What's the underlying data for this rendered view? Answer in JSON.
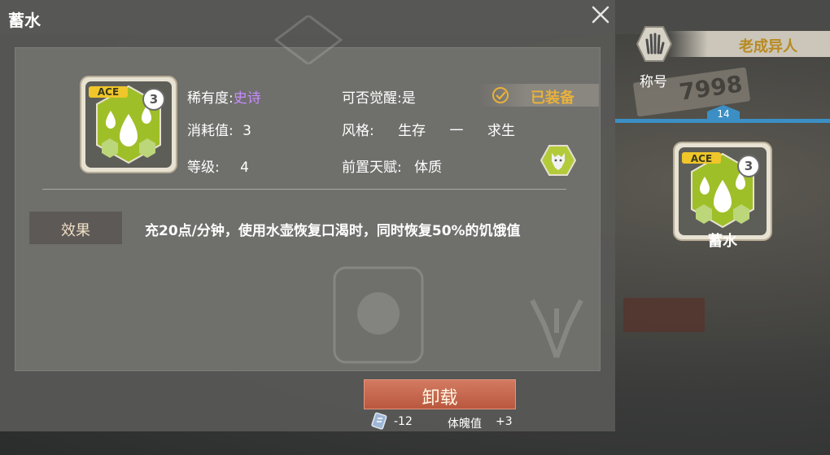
{
  "window": {
    "title": "蓄水"
  },
  "talent": {
    "icon": "water-drops-icon",
    "ace_badge": "ACE",
    "count": "3",
    "rarity_label": "稀有度:",
    "rarity_value": "史诗",
    "awaken_label": "可否觉醒:",
    "awaken_value": "是",
    "equipped_label": "已装备",
    "cost_label": "消耗值:",
    "cost_value": "3",
    "style_label": "风格:",
    "style_value_1": "生存",
    "style_separator": "一",
    "style_value_2": "求生",
    "level_label": "等级:",
    "level_value": "4",
    "prereq_label": "前置天赋:",
    "prereq_value": "体质",
    "prereq_icon": "wolf-icon"
  },
  "effect": {
    "tab_label": "效果",
    "description": "充20点/分钟，使用水壶恢复口渴时，同时恢复50%的饥饿值"
  },
  "actions": {
    "unequip_label": "卸载",
    "cost_icon": "crystal-icon",
    "cost_delta": "-12",
    "stat_label": "体魄值",
    "stat_delta": "+3"
  },
  "side_panel": {
    "title_tag": "老成异人",
    "title_label": "称号",
    "title_icon": "hand-icon",
    "level": "14",
    "slot_name": "蓄水",
    "slot_ace": "ACE",
    "slot_count": "3",
    "plate_text": "7998"
  },
  "colors": {
    "epic": "#c78cff",
    "equipped": "#e8b13a",
    "unequip_button": "#c46a51",
    "accent_blue": "#3b8fc4",
    "title_gold": "#b88a20"
  }
}
